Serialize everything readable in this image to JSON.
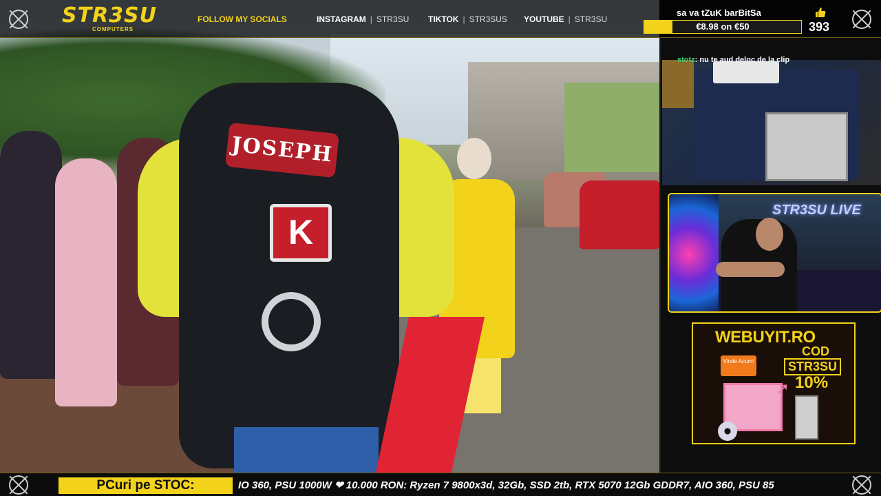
{
  "brand": {
    "logo_main": "STR3SU",
    "logo_sub": "COMPUTERS"
  },
  "topbar": {
    "follow_label": "FOLLOW MY SOCIALS",
    "socials": [
      {
        "network": "INSTAGRAM",
        "handle": "STR3SU"
      },
      {
        "network": "TIKTOK",
        "handle": "STR3SUS"
      },
      {
        "network": "YOUTUBE",
        "handle": "STR3SU"
      }
    ]
  },
  "goal": {
    "title": "sa va tZuK barBitSa",
    "progress_text": "€8.98 on €50",
    "current": 8.98,
    "target": 50,
    "likes": "393",
    "like_icon": "thumbs-up-icon"
  },
  "video": {
    "patch_name": "JOSEPH",
    "patch_letter": "K"
  },
  "chat": {
    "user": "stotz",
    "message": ": nu te aud deloc de la clip"
  },
  "webcam": {
    "neon_sign": "STR3SU LIVE"
  },
  "ad": {
    "brand": "WEBUYIT.RO",
    "cta": "Vinde Acum!",
    "cod_label": "COD",
    "code": "STR3SU",
    "discount": "10%"
  },
  "ticker": {
    "label": "PCuri pe STOC:",
    "text": "IO 360, PSU 1000W ❤ 10.000 RON: Ryzen 7 9800x3d, 32Gb, SSD 2tb, RTX 5070 12Gb GDDR7, AIO 360, PSU 85"
  },
  "colors": {
    "accent": "#f2d21a",
    "chat_user": "#3bd16f"
  }
}
